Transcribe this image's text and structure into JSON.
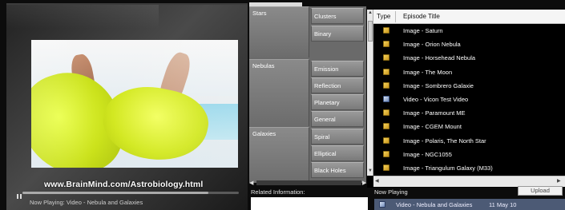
{
  "player": {
    "watermark": "www.BrainMind.com/Astrobiology.html",
    "status": "Now Playing: Video - Nebula and Galaxies",
    "progress_percent": 86
  },
  "categories": [
    {
      "label": "Stars",
      "subs": [
        "Clusters",
        "Binary"
      ]
    },
    {
      "label": "Nebulas",
      "subs": [
        "Emission",
        "Reflection",
        "Planetary",
        "General"
      ]
    },
    {
      "label": "Galaxies",
      "subs": [
        "Spiral",
        "Elliptical",
        "Black Holes"
      ]
    }
  ],
  "list": {
    "headers": {
      "type": "Type",
      "title": "Episode Title"
    },
    "rows": [
      {
        "type": "image",
        "title": "Image - Saturn"
      },
      {
        "type": "image",
        "title": "Image - Orion Nebula"
      },
      {
        "type": "image",
        "title": "Image - Horsehead Nebula"
      },
      {
        "type": "image",
        "title": "Image - The Moon"
      },
      {
        "type": "image",
        "title": "Image - Sombrero Galaxie"
      },
      {
        "type": "video",
        "title": "Video - Vicon Test Video"
      },
      {
        "type": "image",
        "title": "Image - Paramount ME"
      },
      {
        "type": "image",
        "title": "Image - CGEM Mount"
      },
      {
        "type": "image",
        "title": "Image - Polaris, The North Star"
      },
      {
        "type": "image",
        "title": "Image - NGC1055"
      },
      {
        "type": "image",
        "title": "Image - Triangulum Galaxy (M33)"
      }
    ]
  },
  "bottom": {
    "related_label": "Related Information:",
    "now_playing_label": "Now Playing",
    "upload_label": "Upload",
    "now_playing_title": "Video - Nebula and Galaxies",
    "now_playing_date": "11 May 10"
  },
  "icons": {
    "image_row": "image-file-icon",
    "video_row": "video-file-icon"
  }
}
